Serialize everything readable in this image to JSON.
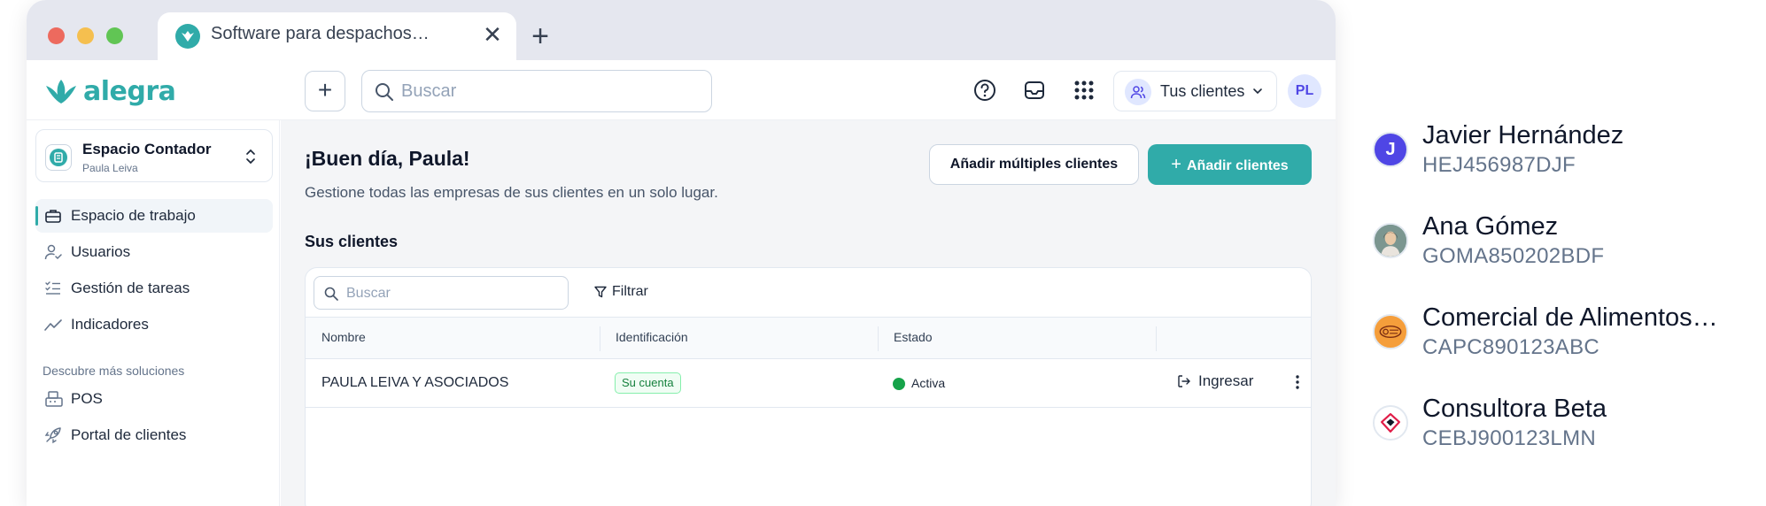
{
  "browser": {
    "tab_title": "Software para despachos…",
    "tab_close": "✕",
    "new_tab": "+"
  },
  "header": {
    "logo_text": "alegra",
    "add_label": "+",
    "search_placeholder": "Buscar",
    "clients_button": "Tus clientes",
    "user_initials": "PL"
  },
  "sidebar": {
    "workspace": {
      "title": "Espacio Contador",
      "subtitle": "Paula Leiva"
    },
    "items": [
      {
        "label": "Espacio de trabajo",
        "icon": "briefcase-icon",
        "active": true
      },
      {
        "label": "Usuarios",
        "icon": "user-check-icon",
        "active": false
      },
      {
        "label": "Gestión de tareas",
        "icon": "task-list-icon",
        "active": false
      },
      {
        "label": "Indicadores",
        "icon": "trend-icon",
        "active": false
      }
    ],
    "section_label": "Descubre más soluciones",
    "more_items": [
      {
        "label": "POS",
        "icon": "pos-register-icon"
      },
      {
        "label": "Portal de clientes",
        "icon": "rocket-icon"
      }
    ]
  },
  "main": {
    "greeting": "¡Buen día, Paula!",
    "subtitle": "Gestione todas las empresas de sus clientes en un solo lugar.",
    "add_multiple_button": "Añadir múltiples clientes",
    "add_clients_button": "Añadir clientes",
    "add_clients_plus": "+",
    "section_title": "Sus clientes",
    "table": {
      "search_placeholder": "Buscar",
      "filter_label": "Filtrar",
      "columns": [
        "Nombre",
        "Identificación",
        "Estado"
      ],
      "rows": [
        {
          "name": "PAULA LEIVA Y ASOCIADOS",
          "identification": "Su cuenta",
          "status": "Activa",
          "action": "Ingresar"
        }
      ]
    }
  },
  "client_list": [
    {
      "name": "Javier Hernández",
      "rfc": "HEJ456987DJF",
      "avatar": "J",
      "color": "#4f46e5"
    },
    {
      "name": "Ana Gómez",
      "rfc": "GOMA850202BDF",
      "avatar": "",
      "color": "#5b7c8a"
    },
    {
      "name": "Comercial de Alimentos…",
      "rfc": "CAPC890123ABC",
      "avatar": "",
      "color": "#f59e3b"
    },
    {
      "name": "Consultora Beta",
      "rfc": "CEBJ900123LMN",
      "avatar": "",
      "color": "#e11d48"
    }
  ],
  "colors": {
    "accent": "#30aba9",
    "status_active": "#16a34a",
    "badge_text": "#15803d"
  }
}
